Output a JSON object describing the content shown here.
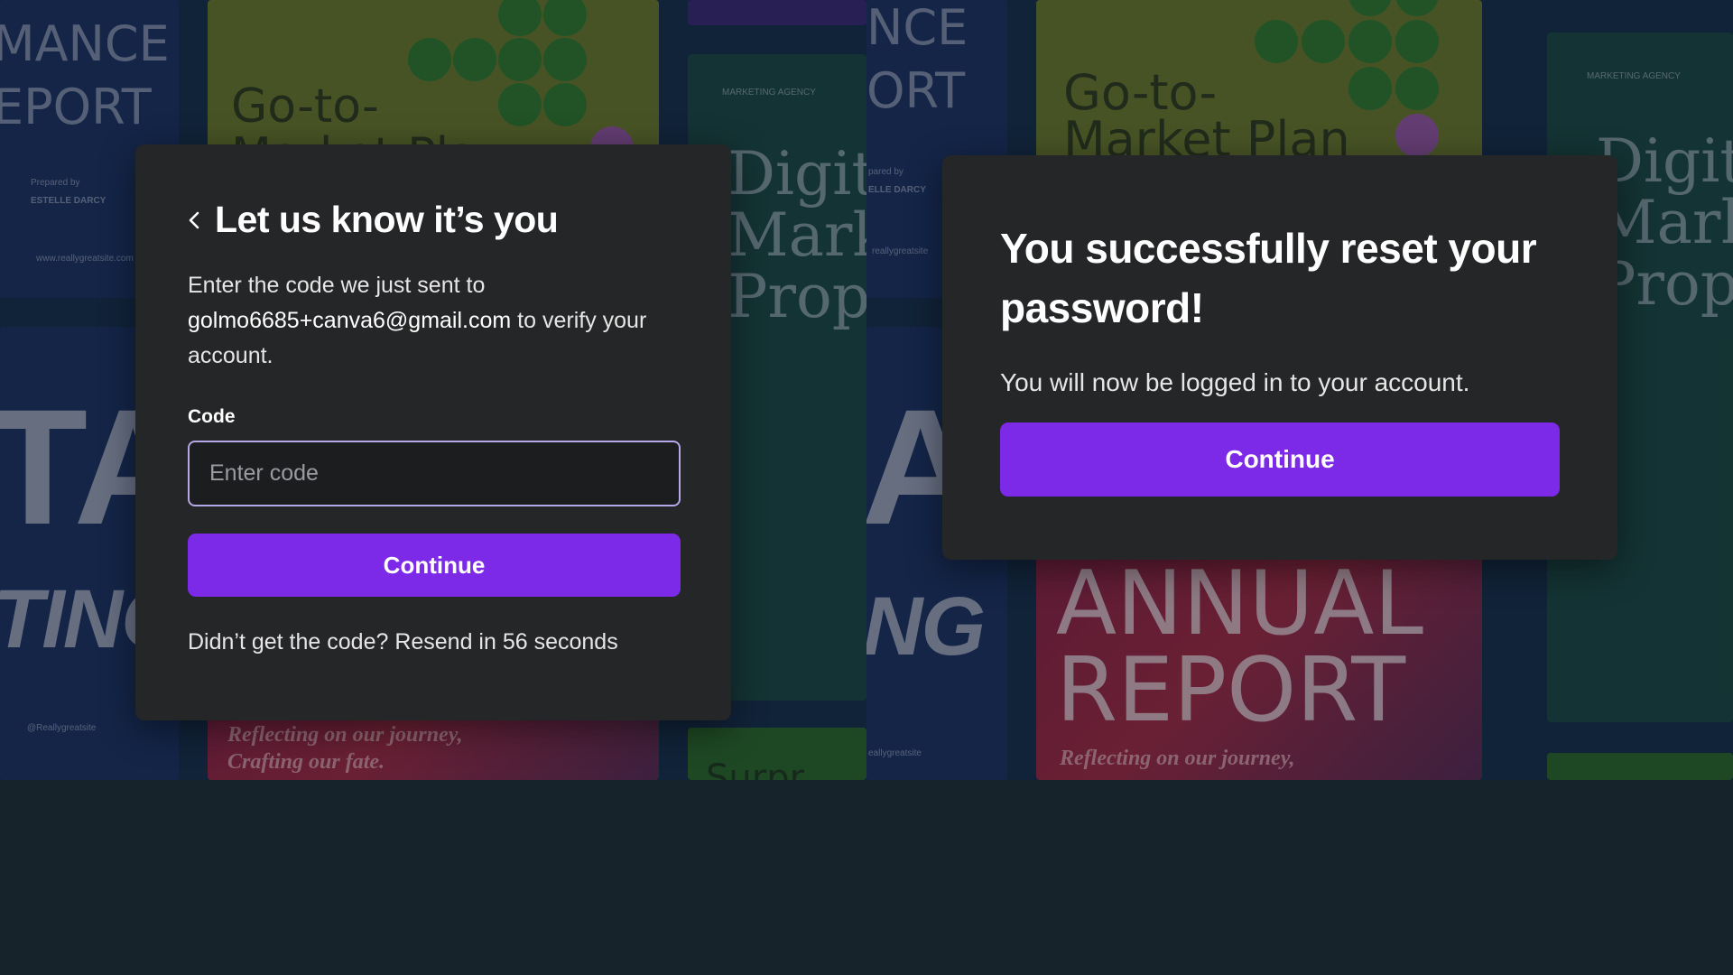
{
  "verify_modal": {
    "title": "Let us know it’s you",
    "description_before": "Enter the code we just sent to ",
    "email": "golmo6685+canva6@gmail.com",
    "description_after": " to verify your account.",
    "code_label": "Code",
    "code_placeholder": "Enter code",
    "code_value": "",
    "continue_label": "Continue",
    "resend_text": "Didn’t get the code? Resend in 56 seconds",
    "back_icon": "chevron-left-icon"
  },
  "success_modal": {
    "title": "You successfully reset your password!",
    "message": "You will now be logged in to your account.",
    "continue_label": "Continue"
  },
  "background": {
    "left": {
      "perf_report_line1": "MANCE",
      "perf_report_line2": "EPORT",
      "prepared_by": "Prepared by",
      "prepared_name": "ESTELLE DARCY",
      "website": "www.reallygreatsite.com",
      "gtm_line1": "Go-to-",
      "gtm_line2": "Market Plan",
      "agency": "MARKETING AGENCY",
      "digital_line1": "Digita",
      "digital_line2": "Mark",
      "digital_line3": "Propo",
      "big_word_1": "TAL",
      "big_word_2": "TING",
      "handle": "@Reallygreatsite",
      "annual_line1": "Reflecting on our journey,",
      "annual_line2": "Crafting our fate.",
      "surprise": "Surpr"
    },
    "right": {
      "perf_report_line1": "NCE",
      "perf_report_line2": "ORT",
      "prepared_by": "pared by",
      "prepared_name": "ELLE DARCY",
      "website": "reallygreatsite",
      "gtm_line1": "Go-to-",
      "gtm_line2": "Market Plan",
      "agency": "MARKETING AGENCY",
      "digital_line1": "Digit",
      "digital_line2": "Mark",
      "digital_line3": "Prop",
      "big_word_1": "AL",
      "big_word_2": "NG",
      "handle": "eallygreatsite",
      "annual_title_1": "ANNUAL",
      "annual_title_2": "REPORT",
      "annual_line1": "Reflecting on our journey,"
    }
  },
  "colors": {
    "page_background": "#17232b",
    "modal_background": "#252627",
    "primary_button": "#7d2ae8",
    "input_border": "#b5a7e8"
  }
}
